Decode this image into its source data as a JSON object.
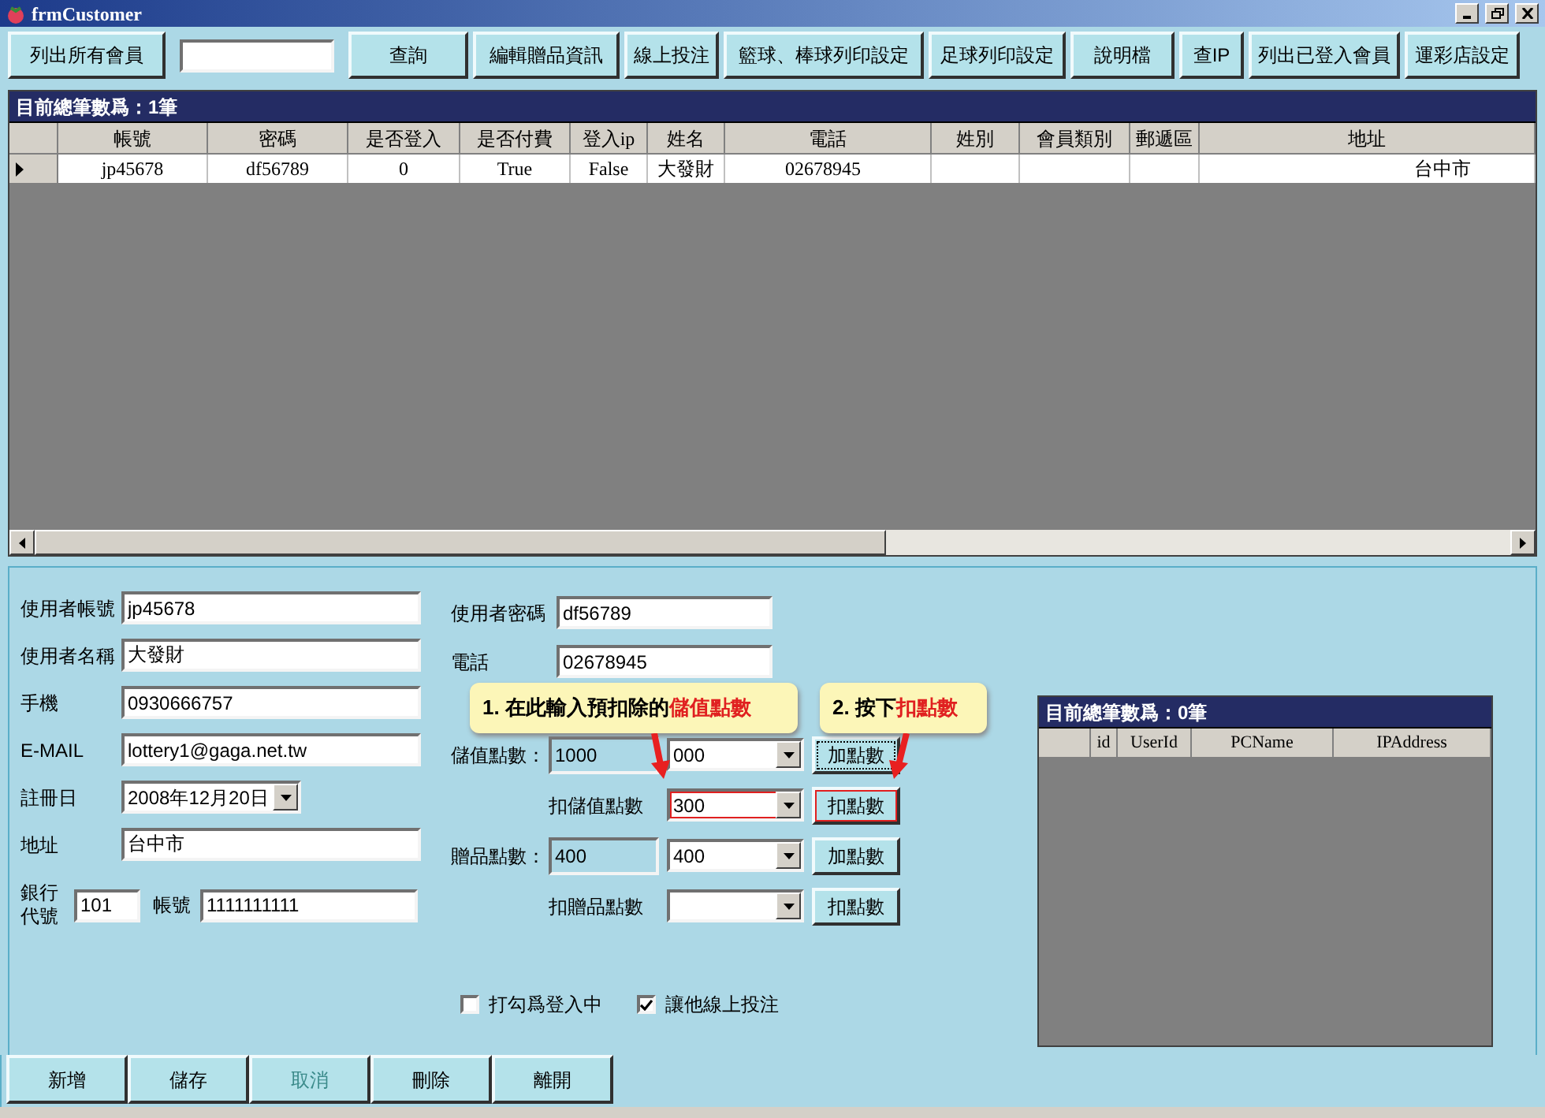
{
  "window": {
    "title": "frmCustomer"
  },
  "toolbar": [
    {
      "kind": "button",
      "label": "列出所有會員"
    },
    {
      "kind": "field"
    },
    {
      "kind": "button",
      "label": "查詢"
    },
    {
      "kind": "button",
      "label": "編輯贈品資訊"
    },
    {
      "kind": "button",
      "label": "線上投注"
    },
    {
      "kind": "button",
      "label": "籃球、棒球列印設定"
    },
    {
      "kind": "button",
      "label": "足球列印設定"
    },
    {
      "kind": "button",
      "label": "說明檔"
    },
    {
      "kind": "button",
      "label": "查IP"
    },
    {
      "kind": "button",
      "label": "列出已登入會員"
    },
    {
      "kind": "button",
      "label": "運彩店設定"
    }
  ],
  "member_grid": {
    "caption": "目前總筆數爲：1筆",
    "columns": [
      "帳號",
      "密碼",
      "是否登入",
      "是否付費",
      "登入ip",
      "姓名",
      "電話",
      "姓別",
      "會員類別",
      "郵遞區",
      "地址"
    ],
    "rows": [
      {
        "current": true,
        "cells": [
          "jp45678",
          "df56789",
          "0",
          "True",
          "False",
          "大發財",
          "02678945",
          null,
          null,
          null,
          "台中市"
        ]
      }
    ]
  },
  "form_left": [
    {
      "kind": "text",
      "label": "使用者帳號",
      "value": "jp45678"
    },
    {
      "kind": "text",
      "label": "使用者名稱",
      "value": "大發財"
    },
    {
      "kind": "text",
      "label": "手機",
      "value": "0930666757"
    },
    {
      "kind": "text",
      "label": "E-MAIL",
      "value": "lottery1@gaga.net.tw"
    },
    {
      "kind": "date",
      "label": "註冊日",
      "value": "2008年12月20日"
    },
    {
      "kind": "text",
      "label": "地址",
      "value": "台中市"
    }
  ],
  "bank": {
    "label": "銀行代號",
    "code": "101",
    "account_label": "帳號",
    "account": "1111111111"
  },
  "form_middle": [
    {
      "label": "使用者密碼",
      "value": "df56789"
    },
    {
      "label": "電話",
      "value": "02678945"
    }
  ],
  "points": [
    {
      "kind": "balance",
      "label": "儲值點數：",
      "balance": "1000",
      "combo": "000",
      "button": "加點數",
      "focused": true,
      "highlighted": false
    },
    {
      "kind": "deduct",
      "label": "扣儲值點數",
      "combo": "300",
      "button": "扣點數",
      "focused": false,
      "highlighted": true
    },
    {
      "kind": "balance",
      "label": "贈品點數：",
      "balance": "400",
      "combo": "400",
      "button": "加點數",
      "focused": false,
      "highlighted": false
    },
    {
      "kind": "deduct",
      "label": "扣贈品點數",
      "button": "扣點數",
      "focused": false,
      "highlighted": false
    }
  ],
  "checkboxes": [
    {
      "label": "打勾爲登入中",
      "checked": false
    },
    {
      "label": "讓他線上投注",
      "checked": true
    }
  ],
  "login_grid": {
    "caption": "目前總筆數爲：0筆",
    "columns": [
      "id",
      "UserId",
      "PCName",
      "IPAddress"
    ]
  },
  "callouts": [
    {
      "text": "1. 在此輸入預扣除的",
      "emphasis": "儲值點數"
    },
    {
      "text": "2. 按下",
      "emphasis": "扣點數"
    }
  ],
  "bottom_buttons": [
    {
      "label": "新增",
      "disabled": false
    },
    {
      "label": "儲存",
      "disabled": false
    },
    {
      "label": "取消",
      "disabled": true
    },
    {
      "label": "刪除",
      "disabled": false
    },
    {
      "label": "離開",
      "disabled": false
    }
  ]
}
